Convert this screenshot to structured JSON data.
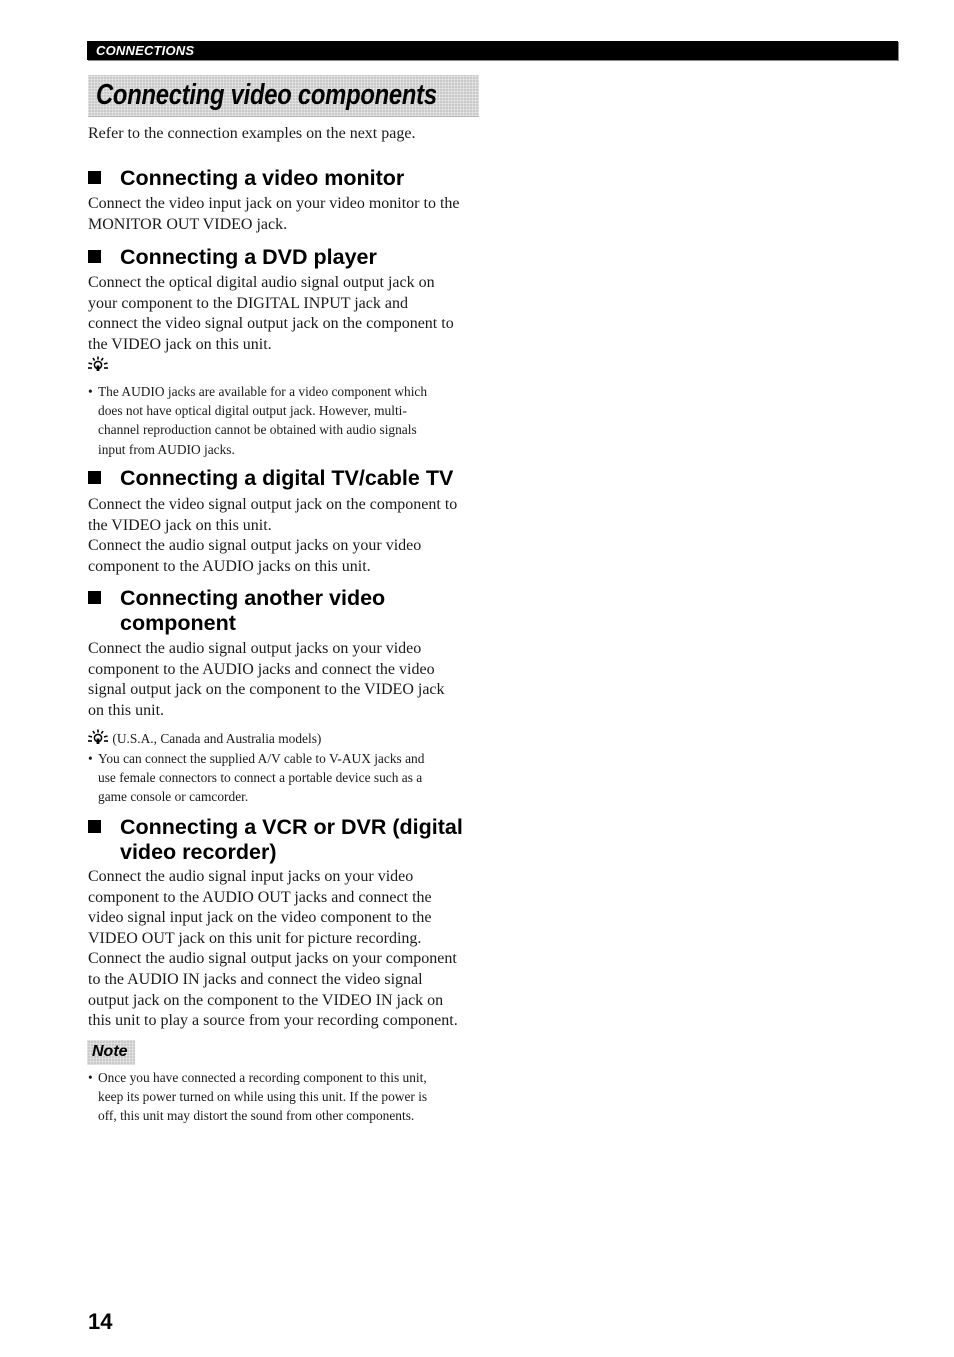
{
  "section_label": "CONNECTIONS",
  "page_title": "Connecting video components",
  "intro": "Refer to the connection examples on the next page.",
  "sections": [
    {
      "heading": [
        "Connecting a video monitor"
      ],
      "body": [
        "Connect the video input jack on your video monitor to the",
        "MONITOR OUT VIDEO jack."
      ]
    },
    {
      "heading": [
        "Connecting a DVD player"
      ],
      "body": [
        "Connect the optical digital audio signal output jack on",
        "your component to the DIGITAL INPUT jack and",
        "connect the video signal output jack on the component to",
        "the VIDEO jack on this unit."
      ],
      "tip": {
        "icon": "lightbulb-tip-icon",
        "label": "",
        "bullets": [
          [
            "The AUDIO jacks are available for a video component which",
            "does not have optical digital output jack. However, multi-",
            "channel reproduction cannot be obtained with audio signals",
            "input from AUDIO jacks."
          ]
        ]
      }
    },
    {
      "heading": [
        "Connecting a digital TV/cable TV"
      ],
      "body": [
        "Connect the video signal output jack on the component to",
        "the VIDEO jack on this unit.",
        "Connect the audio signal output jacks on your video",
        "component to the AUDIO jacks on this unit."
      ]
    },
    {
      "heading": [
        "Connecting another video",
        "component"
      ],
      "body": [
        "Connect the audio signal output jacks on your video",
        "component to the AUDIO jacks and connect the video",
        "signal output jack on the component to the VIDEO jack",
        "on this unit."
      ],
      "tip": {
        "icon": "lightbulb-tip-icon",
        "label": "(U.S.A., Canada and Australia models)",
        "bullets": [
          [
            "You can connect the supplied A/V cable to V-AUX jacks and",
            "use female connectors to connect a portable device such as a",
            "game console or camcorder."
          ]
        ]
      }
    },
    {
      "heading": [
        "Connecting a VCR or DVR (digital",
        "video recorder)"
      ],
      "body": [
        "Connect the audio signal input jacks on your video",
        "component to the AUDIO OUT jacks and connect the",
        "video signal input jack on the video component to the",
        "VIDEO OUT jack on this unit for picture recording.",
        "Connect the audio signal output jacks on your component",
        "to the AUDIO IN jacks and connect the video signal",
        "output jack on the component to the VIDEO IN jack on",
        "this unit to play a source from your recording component."
      ]
    }
  ],
  "note": {
    "label": "Note",
    "bullets": [
      [
        "Once you have connected a recording component to this unit,",
        "keep its power turned on while using this unit. If the power is",
        "off, this unit may distort the sound from other components."
      ]
    ]
  },
  "bullet_char": "•",
  "page_number": "14",
  "colors": {
    "header_bar": "#000000",
    "banner_bg": "#c9c9c9",
    "text": "#111111"
  }
}
